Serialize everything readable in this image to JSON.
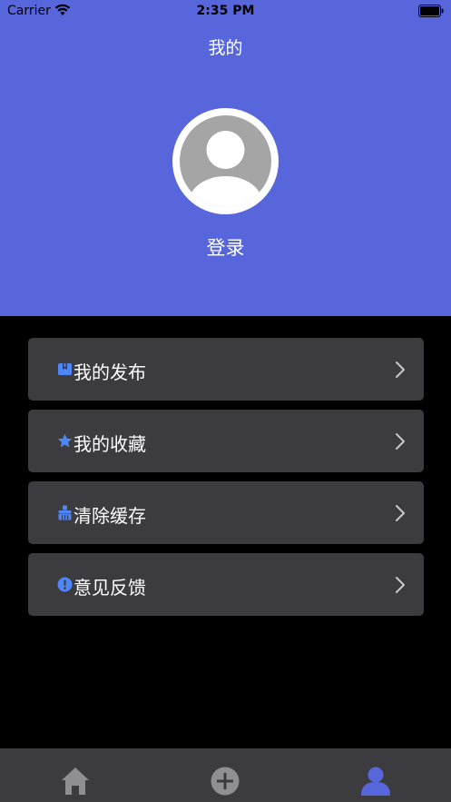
{
  "status_bar": {
    "carrier": "Carrier",
    "time": "2:35 PM"
  },
  "header": {
    "title": "我的",
    "login_label": "登录",
    "background_color": "#5766DB"
  },
  "menu": {
    "items": [
      {
        "label": "我的发布",
        "icon": "publish-icon"
      },
      {
        "label": "我的收藏",
        "icon": "star-icon"
      },
      {
        "label": "清除缓存",
        "icon": "broom-icon"
      },
      {
        "label": "意见反馈",
        "icon": "feedback-icon"
      }
    ],
    "icon_color": "#4F86F7",
    "item_background": "#3C3C40"
  },
  "tabbar": {
    "tabs": [
      {
        "icon": "home-icon",
        "active": false
      },
      {
        "icon": "add-circle-icon",
        "active": false
      },
      {
        "icon": "profile-icon",
        "active": true
      }
    ],
    "active_color": "#5766DB",
    "inactive_color": "#8E8E93"
  }
}
